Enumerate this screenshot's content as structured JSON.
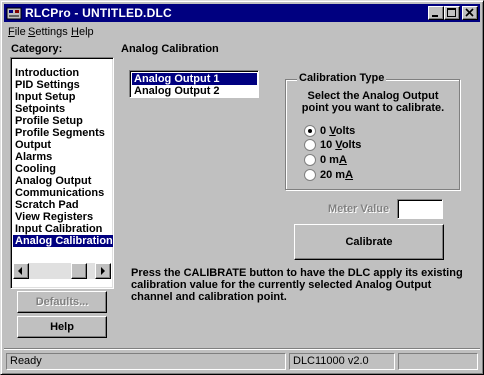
{
  "window": {
    "title": "RLCPro - UNTITLED.DLC"
  },
  "menu": [
    {
      "label": "File",
      "hotkey": "F",
      "rest": "ile"
    },
    {
      "label": "Settings",
      "hotkey": "S",
      "rest": "ettings"
    },
    {
      "label": "Help",
      "hotkey": "H",
      "rest": "elp"
    }
  ],
  "category": {
    "label": "Category:",
    "items": [
      "Introduction",
      "PID Settings",
      "Input Setup",
      "Setpoints",
      "Profile Setup",
      "Profile Segments",
      "Output",
      "Alarms",
      "Cooling",
      "Analog Output",
      "Communications",
      "Scratch Pad",
      "View Registers",
      "Input Calibration",
      "Analog Calibration"
    ],
    "selected_index": 14
  },
  "buttons": {
    "defaults": "Defaults...",
    "help": "Help",
    "calibrate": "Calibrate"
  },
  "main": {
    "title": "Analog Calibration",
    "outputs": [
      "Analog Output 1",
      "Analog Output 2"
    ],
    "selected_output_index": 0,
    "calibration_type": {
      "title": "Calibration Type",
      "desc_line1": "Select the Analog Output",
      "desc_line2": "point you want to calibrate.",
      "options": [
        {
          "pre": "0 ",
          "hot": "V",
          "post": "olts",
          "checked": true
        },
        {
          "pre": "10 ",
          "hot": "V",
          "post": "olts",
          "checked": false
        },
        {
          "pre": "0 m",
          "hot": "A",
          "post": "",
          "checked": false
        },
        {
          "pre": "20 m",
          "hot": "A",
          "post": "",
          "checked": false
        }
      ]
    },
    "meter_value": {
      "label": "Meter Value",
      "value": ""
    },
    "note_line1": "Press the CALIBRATE button to have the DLC apply its existing",
    "note_line2": "calibration value for the currently selected Analog Output",
    "note_line3": "channel and calibration point."
  },
  "status": {
    "left": "Ready",
    "middle": "DLC11000 v2.0",
    "right": ""
  }
}
